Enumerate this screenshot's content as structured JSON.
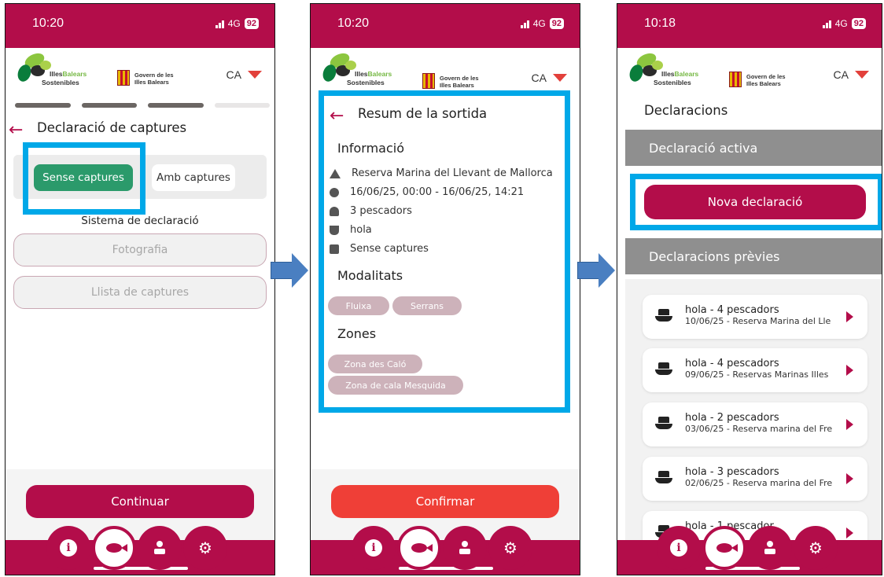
{
  "common": {
    "logo_illes": "Illes",
    "logo_balears": "Balears",
    "logo_sostenibles": "Sostenibles",
    "gov_line1": "Govern de les",
    "gov_line2": "Illes Balears",
    "language": "CA",
    "network": "4G",
    "battery": "92"
  },
  "screen1": {
    "time": "10:20",
    "title": "Declaració de captures",
    "option_no_catch": "Sense captures",
    "option_with_catch": "Amb captures",
    "system_label": "Sistema de declaració",
    "photo_button": "Fotografia",
    "list_button": "Llista de captures",
    "continue_button": "Continuar"
  },
  "screen2": {
    "time": "10:20",
    "title": "Resum de la sortida",
    "info_heading": "Informació",
    "info_reserve": "Reserva Marina del Llevant de Mallorca",
    "info_dates": "16/06/25, 00:00 - 16/06/25, 14:21",
    "info_fishers": "3 pescadors",
    "info_boat": "hola",
    "info_catches": "Sense captures",
    "modalities_heading": "Modalitats",
    "modalities": [
      "Fluixa",
      "Serrans"
    ],
    "zones_heading": "Zones",
    "zones": [
      "Zona des Caló",
      "Zona de cala Mesquida"
    ],
    "confirm_button": "Confirmar"
  },
  "screen3": {
    "time": "10:18",
    "title": "Declaracions",
    "active_heading": "Declaració activa",
    "new_button": "Nova declaració",
    "previous_heading": "Declaracions prèvies",
    "items": [
      {
        "title": "hola - 4 pescadors",
        "subtitle": "10/06/25 - Reserva Marina del Lle"
      },
      {
        "title": "hola - 4 pescadors",
        "subtitle": "09/06/25 - Reservas Marinas Illes"
      },
      {
        "title": "hola - 2 pescadors",
        "subtitle": "03/06/25 - Reserva marina del Fre"
      },
      {
        "title": "hola - 3 pescadors",
        "subtitle": "02/06/25 - Reserva marina del Fre"
      },
      {
        "title": "hola - 1 pescador",
        "subtitle": ""
      }
    ]
  },
  "colors": {
    "brand": "#b30d4a",
    "confirm": "#ef3f37",
    "green": "#2b9a6b",
    "highlight": "#00a8e8",
    "arrow": "#4a7fc1"
  }
}
